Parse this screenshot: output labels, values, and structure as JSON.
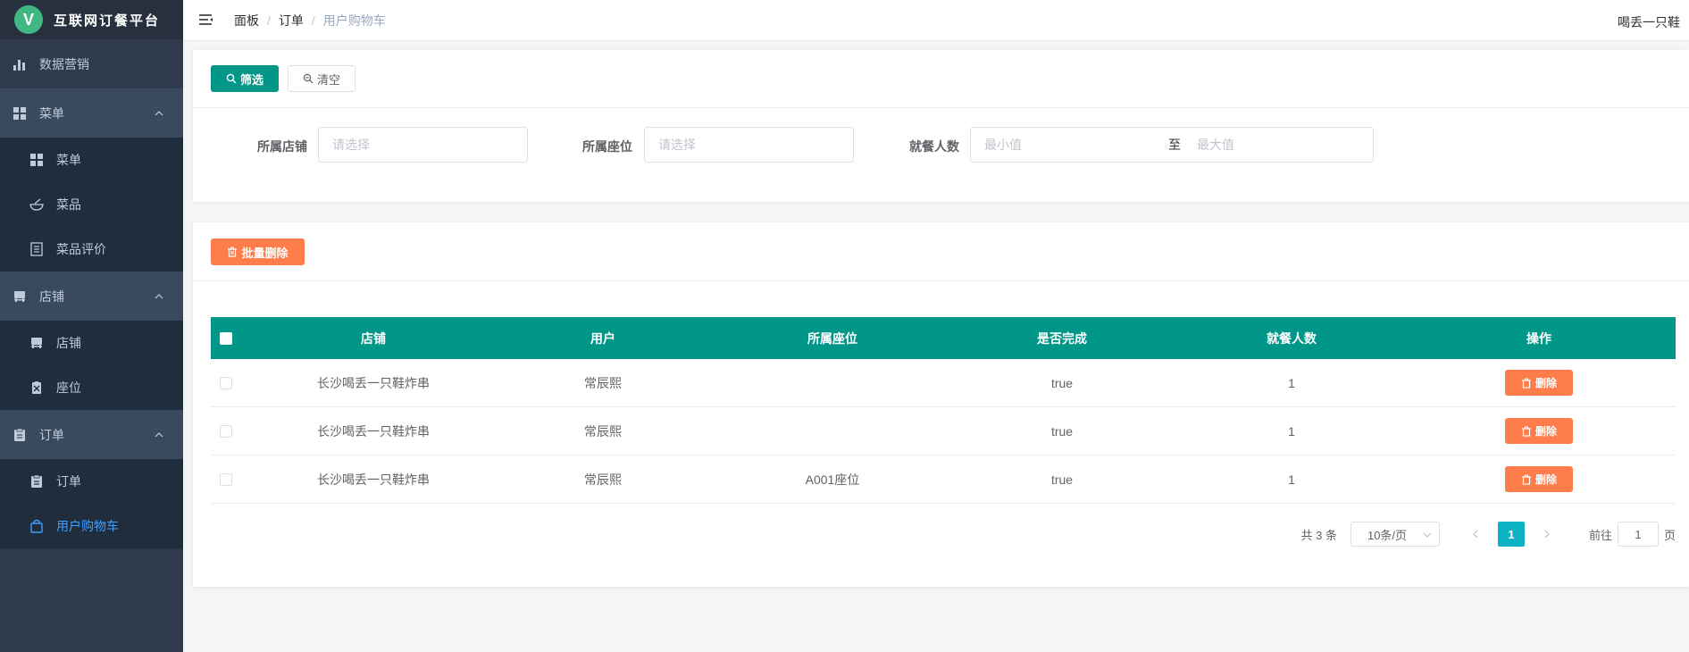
{
  "app": {
    "logo_letter": "V",
    "title": "互联网订餐平台"
  },
  "sidebar": {
    "items": [
      {
        "label": "数据营销",
        "icon": "bar-chart-icon"
      },
      {
        "label": "菜单",
        "icon": "grid-icon",
        "expanded": true,
        "children": [
          {
            "label": "菜单",
            "icon": "grid-icon"
          },
          {
            "label": "菜品",
            "icon": "bowl-icon"
          },
          {
            "label": "菜品评价",
            "icon": "list-icon"
          }
        ]
      },
      {
        "label": "店铺",
        "icon": "store-icon",
        "expanded": true,
        "children": [
          {
            "label": "店铺",
            "icon": "store-icon"
          },
          {
            "label": "座位",
            "icon": "seat-icon"
          }
        ]
      },
      {
        "label": "订单",
        "icon": "clipboard-icon",
        "expanded": true,
        "children": [
          {
            "label": "订单",
            "icon": "clipboard-icon"
          },
          {
            "label": "用户购物车",
            "icon": "bag-icon",
            "active": true
          }
        ]
      }
    ]
  },
  "header": {
    "breadcrumb": [
      "面板",
      "订单",
      "用户购物车"
    ],
    "user": "喝丢一只鞋"
  },
  "filter": {
    "search_label": "筛选",
    "clear_label": "清空",
    "fields": {
      "store": {
        "label": "所属店铺",
        "placeholder": "请选择"
      },
      "seat": {
        "label": "所属座位",
        "placeholder": "请选择"
      },
      "diners": {
        "label": "就餐人数",
        "min_placeholder": "最小值",
        "sep": "至",
        "max_placeholder": "最大值"
      }
    }
  },
  "toolbar": {
    "batch_delete_label": "批量删除"
  },
  "table": {
    "columns": [
      "店铺",
      "用户",
      "所属座位",
      "是否完成",
      "就餐人数",
      "操作"
    ],
    "rows": [
      {
        "store": "长沙喝丢一只鞋炸串",
        "user": "常辰熙",
        "seat": "",
        "done": "true",
        "diners": "1",
        "action": "删除"
      },
      {
        "store": "长沙喝丢一只鞋炸串",
        "user": "常辰熙",
        "seat": "",
        "done": "true",
        "diners": "1",
        "action": "删除"
      },
      {
        "store": "长沙喝丢一只鞋炸串",
        "user": "常辰熙",
        "seat": "A001座位",
        "done": "true",
        "diners": "1",
        "action": "删除"
      }
    ]
  },
  "pagination": {
    "total": "共 3 条",
    "page_size": "10条/页",
    "current_page": "1",
    "goto_prefix": "前往",
    "goto_value": "1",
    "goto_suffix": "页"
  },
  "colors": {
    "primary": "#009688",
    "danger": "#ff7d4a",
    "sidebar": "#2f3b4d",
    "active_link": "#409eff",
    "page_active": "#0cb1c4"
  }
}
